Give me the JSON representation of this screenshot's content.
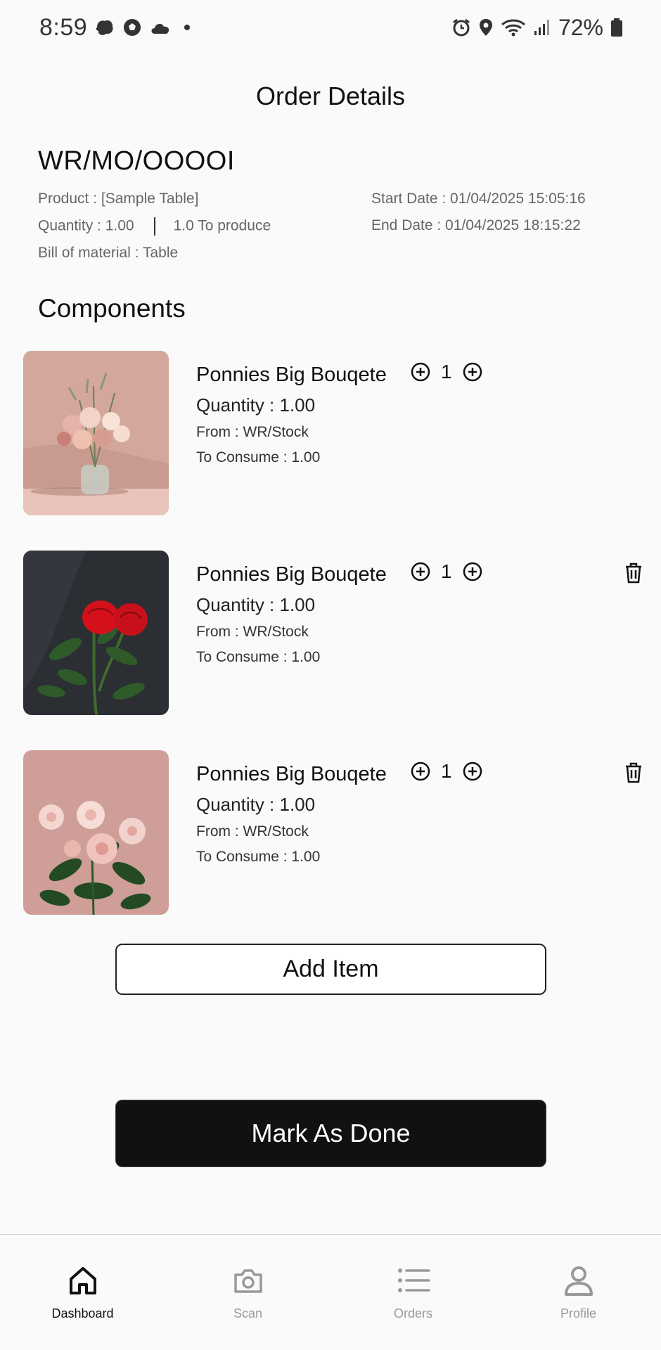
{
  "status_bar": {
    "time": "8:59",
    "battery": "72%"
  },
  "header": {
    "title": "Order Details"
  },
  "order": {
    "reference": "WR/MO/OOOOI",
    "product": "Product : [Sample Table]",
    "quantity": "Quantity : 1.00",
    "to_produce": "1.0  To produce",
    "bill_of_material": "Bill of material : Table",
    "start_date": "Start Date : 01/04/2025 15:05:16",
    "end_date": "End Date : 01/04/2025 18:15:22"
  },
  "components": {
    "title": "Components",
    "items": [
      {
        "name": "Ponnies Big Bouqete",
        "count": "1",
        "quantity": "Quantity : 1.00",
        "from": "From : WR/Stock",
        "to_consume": "To Consume : 1.00",
        "image": "pink-bouquet-in-vase",
        "deletable": false
      },
      {
        "name": "Ponnies Big Bouqete",
        "count": "1",
        "quantity": "Quantity : 1.00",
        "from": "From : WR/Stock",
        "to_consume": "To Consume : 1.00",
        "image": "red-roses-dark-background",
        "deletable": true
      },
      {
        "name": "Ponnies Big Bouqete",
        "count": "1",
        "quantity": "Quantity : 1.00",
        "from": "From : WR/Stock",
        "to_consume": "To Consume : 1.00",
        "image": "pink-roses-pink-background",
        "deletable": true
      }
    ]
  },
  "actions": {
    "add_item": "Add Item",
    "mark_done": "Mark As Done"
  },
  "nav": {
    "items": [
      {
        "label": "Dashboard",
        "icon": "home-icon",
        "active": true
      },
      {
        "label": "Scan",
        "icon": "camera-icon",
        "active": false
      },
      {
        "label": "Orders",
        "icon": "list-icon",
        "active": false
      },
      {
        "label": "Profile",
        "icon": "user-icon",
        "active": false
      }
    ]
  },
  "colors": {
    "background": "#fafafa",
    "primary_button": "#111111",
    "text_muted": "#666666"
  }
}
